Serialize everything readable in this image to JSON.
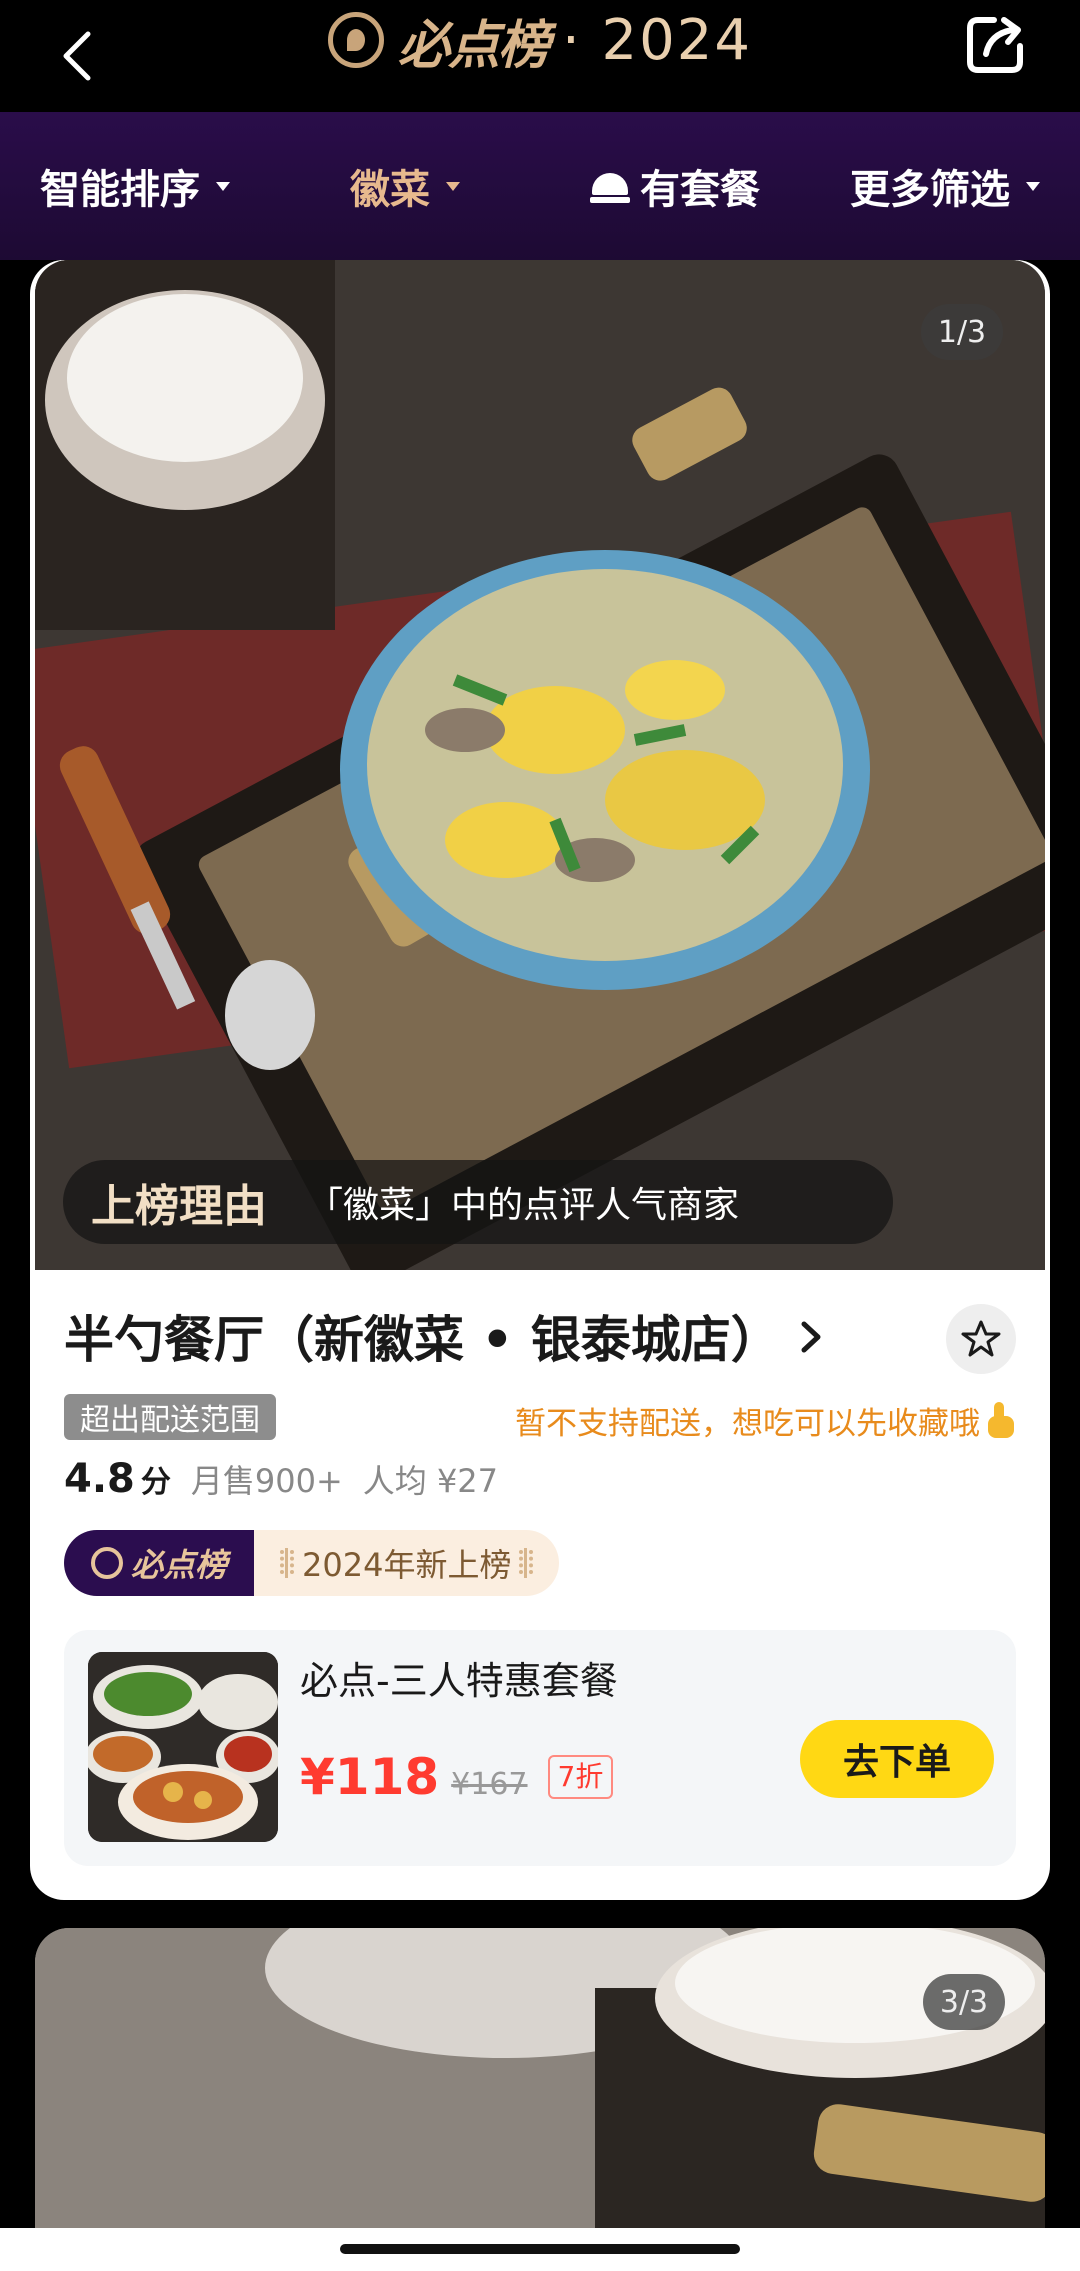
{
  "header": {
    "brand_name": "必点榜",
    "brand_year": "· 2024",
    "icons": [
      "back-icon",
      "share-icon"
    ]
  },
  "filters": [
    {
      "label": "智能排序",
      "active": false
    },
    {
      "label": "徽菜",
      "active": true
    },
    {
      "label": "有套餐",
      "active": false
    },
    {
      "label": "更多筛选",
      "active": false
    }
  ],
  "card": {
    "image_counter": "1/3",
    "reason_title": "上榜理由",
    "reason_text": "「徽菜」中的点评人气商家",
    "store_name": "半勺餐厅（新徽菜 • 银泰城店）",
    "out_of_range_tag": "超出配送范围",
    "delivery_note": "暂不支持配送，想吃可以先收藏哦",
    "score": "4.8",
    "score_unit": "分",
    "monthly_sales": "月售900+",
    "avg_price": "人均 ¥27",
    "badge_brand": "必点榜",
    "badge_new": "2024年新上榜",
    "package": {
      "name": "必点-三人特惠套餐",
      "price": "¥118",
      "original_price": "¥167",
      "discount": "7折",
      "order_label": "去下单"
    }
  },
  "next_card": {
    "image_counter": "3/3"
  },
  "colors": {
    "accent_gold": "#e7b98e",
    "filter_bg": "#2a0d4a",
    "price_red": "#ff3b30",
    "order_yellow": "#ffd814",
    "delivery_orange": "#e88b1c"
  }
}
